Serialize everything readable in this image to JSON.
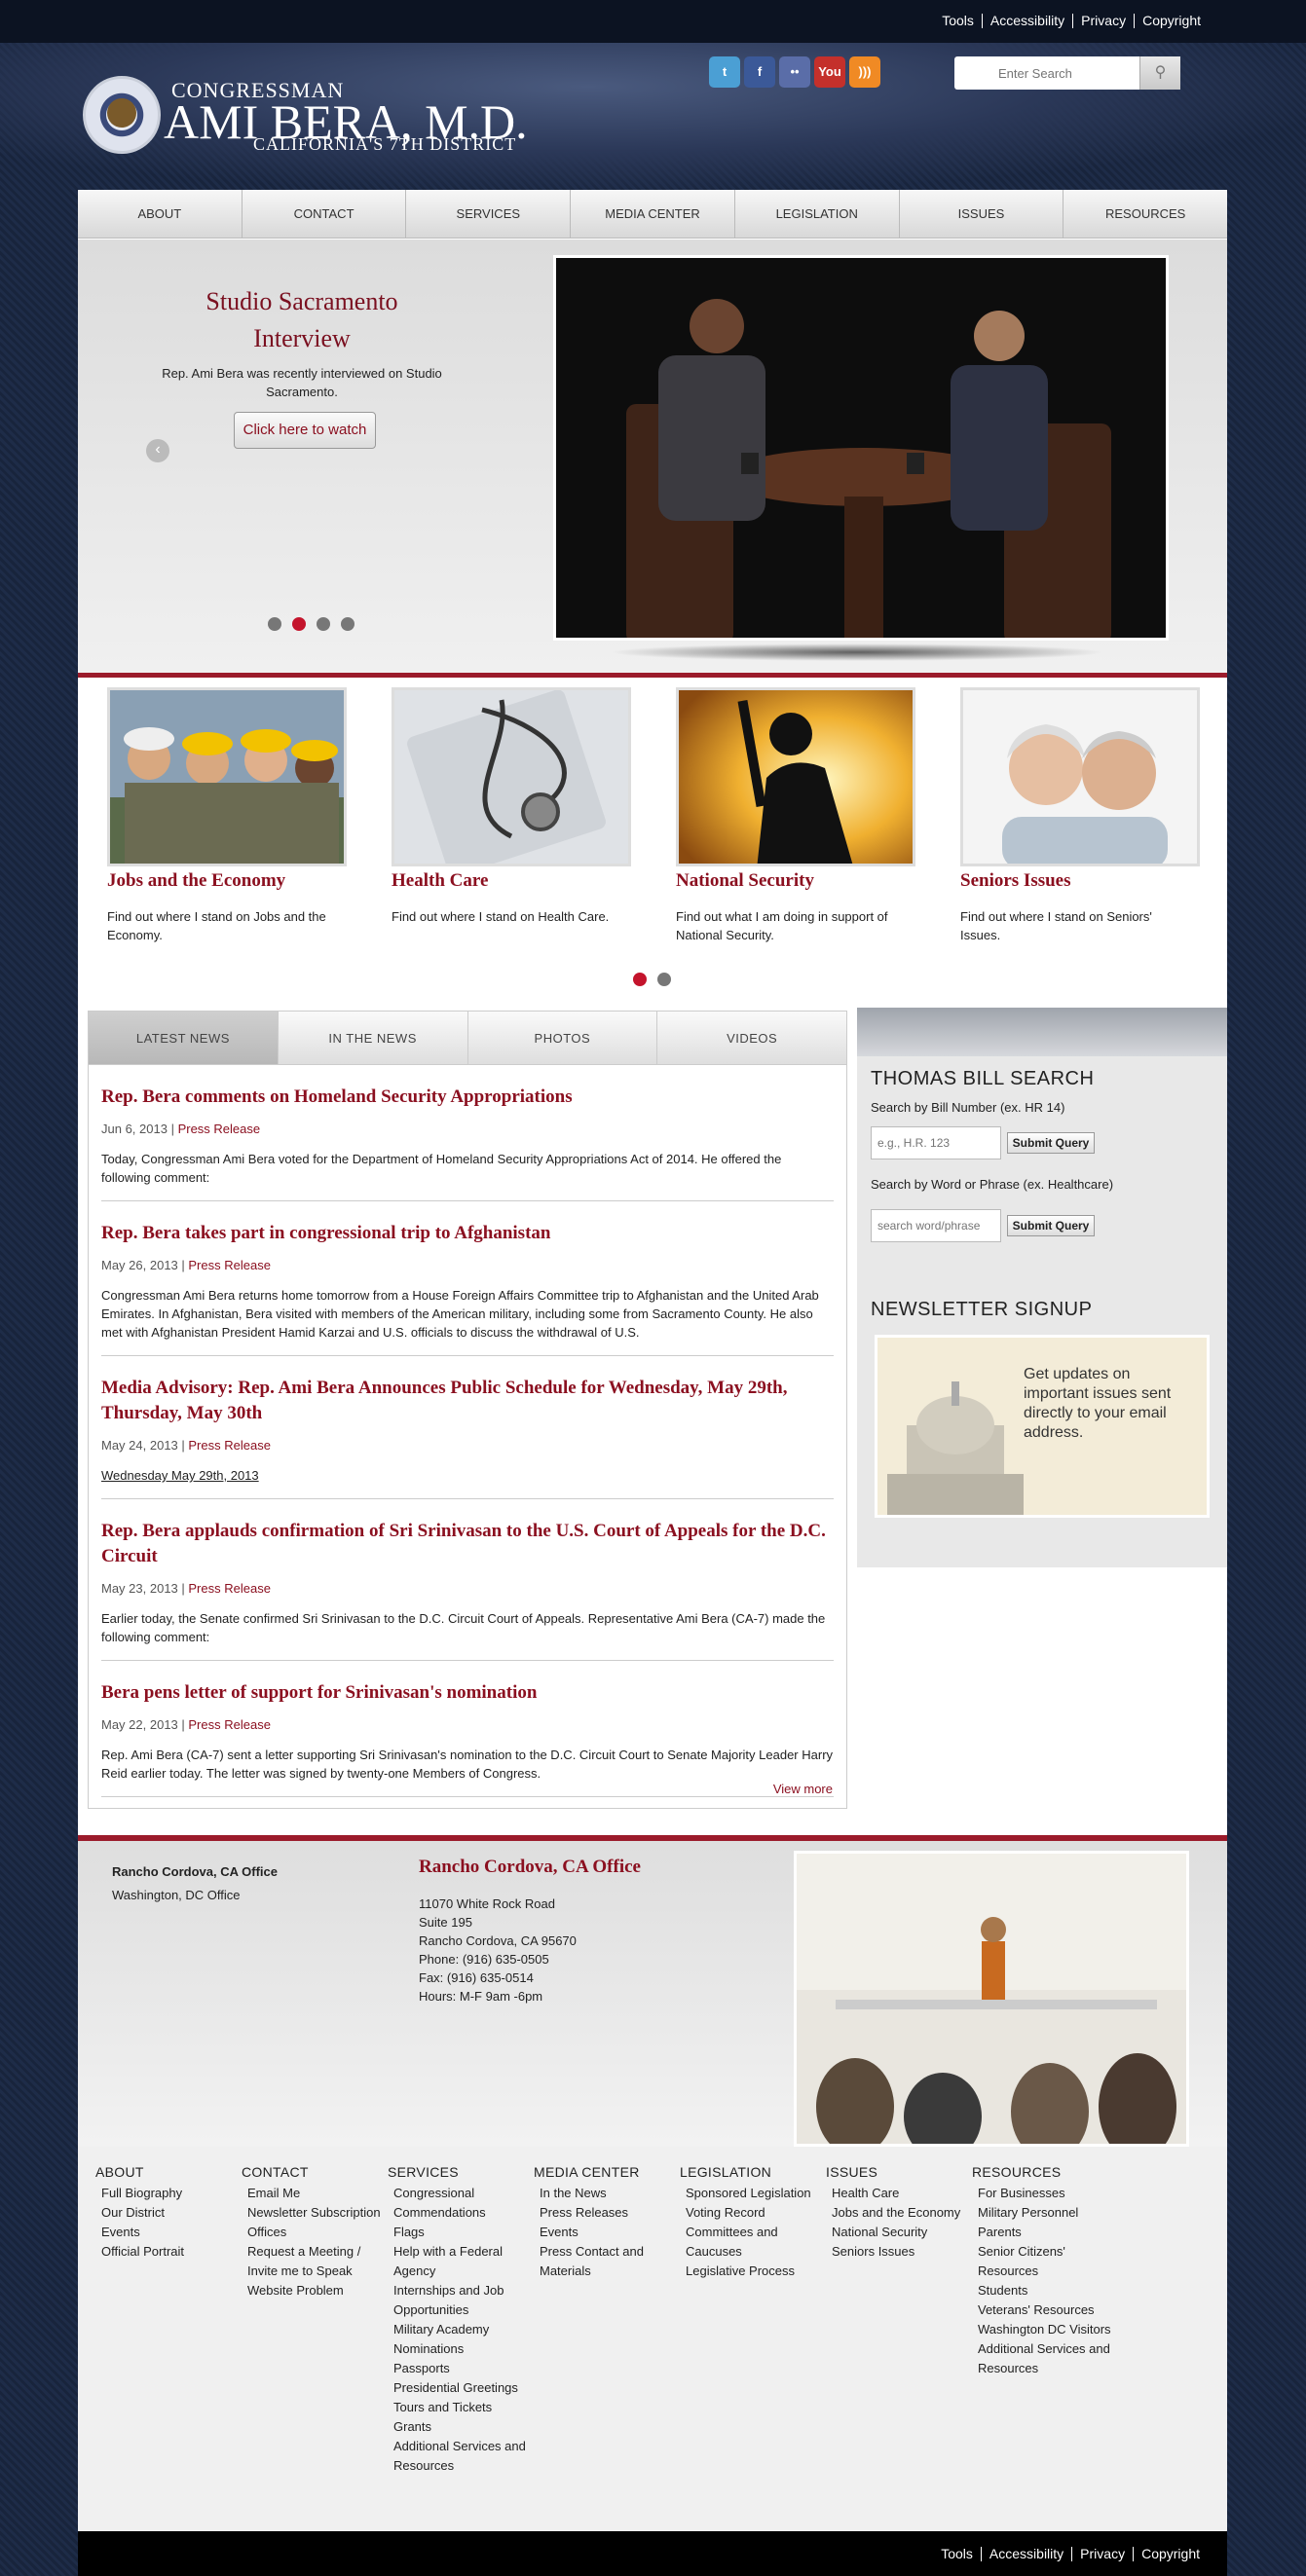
{
  "utility_links": [
    "Tools",
    "Accessibility",
    "Privacy",
    "Copyright"
  ],
  "logo": {
    "line1": "CONGRESSMAN",
    "line2": "AMI BERA, M.D.",
    "line3": "CALIFORNIA'S 7TH DISTRICT"
  },
  "social": [
    {
      "name": "twitter-icon",
      "glyph": "t",
      "color": "#4b9fd4"
    },
    {
      "name": "facebook-icon",
      "glyph": "f",
      "color": "#3b5998"
    },
    {
      "name": "flickr-icon",
      "glyph": "••",
      "color": "#5a6da8"
    },
    {
      "name": "youtube-icon",
      "glyph": "You",
      "color": "#c4302b"
    },
    {
      "name": "rss-icon",
      "glyph": ")))",
      "color": "#f08a24"
    }
  ],
  "search": {
    "placeholder": "Enter Search"
  },
  "nav": [
    "ABOUT",
    "CONTACT",
    "SERVICES",
    "MEDIA CENTER",
    "LEGISLATION",
    "ISSUES",
    "RESOURCES"
  ],
  "slide": {
    "title": "Studio Sacramento Interview",
    "text": "Rep. Ami Bera was recently interviewed on Studio Sacramento.",
    "button": "Click here to watch",
    "dot_count": 4,
    "active_dot": 1
  },
  "featured": [
    {
      "title": "Jobs and the Economy",
      "text": "Find out where I stand on Jobs and the Economy."
    },
    {
      "title": "Health Care",
      "text": "Find out where I stand on Health Care."
    },
    {
      "title": "National Security",
      "text": "Find out what I am doing in support of National Security."
    },
    {
      "title": "Seniors Issues",
      "text": "Find out where I stand on Seniors' Issues."
    }
  ],
  "featured_dots": {
    "count": 2,
    "active": 0
  },
  "news_tabs": [
    "LATEST NEWS",
    "IN THE NEWS",
    "PHOTOS",
    "VIDEOS"
  ],
  "articles": [
    {
      "title": "Rep. Bera comments on Homeland Security Appropriations",
      "date": "Jun 6, 2013",
      "type": "Press Release",
      "excerpt": "Today, Congressman Ami Bera voted for the Department of Homeland Security Appropriations Act of 2014. He offered the following comment:"
    },
    {
      "title": "Rep. Bera takes part in congressional trip to Afghanistan",
      "date": "May 26, 2013",
      "type": "Press Release",
      "excerpt": "Congressman Ami Bera returns home tomorrow from a House Foreign Affairs Committee trip to Afghanistan and the United Arab Emirates. In Afghanistan, Bera visited with members of the American military, including some from Sacramento County. He also met with Afghanistan President Hamid Karzai and U.S. officials to discuss the withdrawal of U.S."
    },
    {
      "title": "Media Advisory: Rep. Ami Bera Announces Public Schedule for Wednesday, May 29th, Thursday, May 30th",
      "date": "May 24, 2013",
      "type": "Press Release",
      "excerpt": "Wednesday May 29th, 2013"
    },
    {
      "title": "Rep. Bera applauds confirmation of Sri Srinivasan to the U.S. Court of Appeals for the D.C. Circuit",
      "date": "May 23, 2013",
      "type": "Press Release",
      "excerpt": "Earlier today, the Senate confirmed Sri Srinivasan to the D.C. Circuit Court of Appeals. Representative Ami Bera (CA-7) made the following comment:"
    },
    {
      "title": "Bera pens letter of support for Srinivasan's nomination",
      "date": "May 22, 2013",
      "type": "Press Release",
      "excerpt": "Rep. Ami Bera (CA-7) sent a letter supporting Sri Srinivasan's nomination to the D.C. Circuit Court to Senate Majority Leader Harry Reid earlier today. The letter was signed by twenty-one Members of Congress."
    }
  ],
  "view_more": "View more",
  "bill_search": {
    "heading": "THOMAS BILL SEARCH",
    "label1": "Search by Bill Number (ex. HR 14)",
    "placeholder1": "e.g., H.R. 123",
    "button1": "Submit Query",
    "label2": "Search by Word or Phrase (ex. Healthcare)",
    "placeholder2": "search word/phrase",
    "button2": "Submit Query"
  },
  "newsletter": {
    "heading": "NEWSLETTER SIGNUP",
    "text": "Get updates on important issues sent directly to your email address."
  },
  "offices": {
    "list": [
      "Rancho Cordova, CA Office",
      "Washington, DC Office"
    ],
    "title": "Rancho Cordova, CA Office",
    "address": [
      "11070 White Rock Road",
      "Suite 195",
      "Rancho Cordova, CA 95670",
      "Phone: (916) 635-0505",
      "Fax: (916) 635-0514",
      "Hours: M-F 9am -6pm"
    ]
  },
  "sitemap": [
    {
      "heading": "ABOUT",
      "items": [
        "Full Biography",
        "Our District",
        "Events",
        "Official Portrait"
      ]
    },
    {
      "heading": "CONTACT",
      "items": [
        "Email Me",
        "Newsletter Subscription",
        "Offices",
        "Request a Meeting / Invite me to Speak",
        "Website Problem"
      ]
    },
    {
      "heading": "SERVICES",
      "items": [
        "Congressional Commendations",
        "Flags",
        "Help with a Federal Agency",
        "Internships and Job Opportunities",
        "Military Academy Nominations",
        "Passports",
        "Presidential Greetings",
        "Tours and Tickets",
        "Grants",
        "Additional Services and Resources"
      ]
    },
    {
      "heading": "MEDIA CENTER",
      "items": [
        "In the News",
        "Press Releases",
        "Events",
        "Press Contact and Materials"
      ]
    },
    {
      "heading": "LEGISLATION",
      "items": [
        "Sponsored Legislation",
        "Voting Record",
        "Committees and Caucuses",
        "Legislative Process"
      ]
    },
    {
      "heading": "ISSUES",
      "items": [
        "Health Care",
        "Jobs and the Economy",
        "National Security",
        "Seniors Issues"
      ]
    },
    {
      "heading": "RESOURCES",
      "items": [
        "For Businesses",
        "Military Personnel",
        "Parents",
        "Senior Citizens' Resources",
        "Students",
        "Veterans' Resources",
        "Washington DC Visitors",
        "Additional Services and Resources"
      ]
    }
  ],
  "colors": {
    "accent": "#8b1020",
    "rule": "#9b1b2b",
    "dot_active": "#c4142c"
  }
}
